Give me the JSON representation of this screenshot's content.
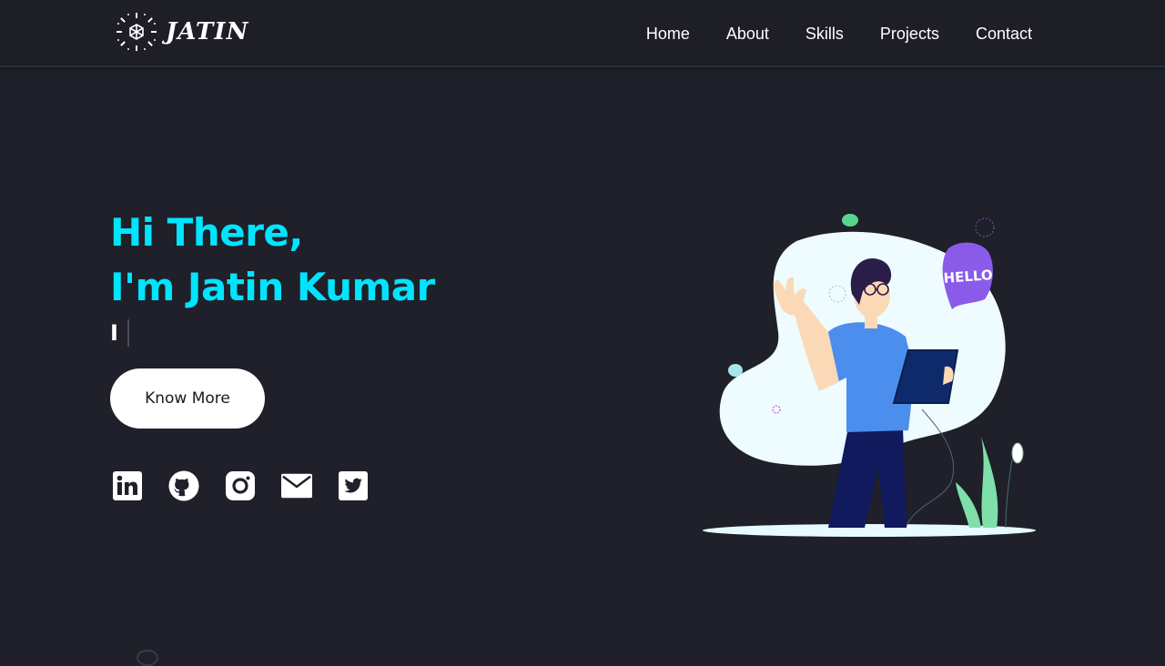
{
  "brand": {
    "name": "JATIN",
    "logo_icon": "sun-logo-icon"
  },
  "nav": {
    "items": [
      {
        "label": "Home"
      },
      {
        "label": "About"
      },
      {
        "label": "Skills"
      },
      {
        "label": "Projects"
      },
      {
        "label": "Contact"
      }
    ]
  },
  "hero": {
    "greeting": "Hi There,",
    "name_line": "I'm Jatin Kumar",
    "typed_text": "I",
    "cta_label": "Know More",
    "illustration_bubble_text": "HELLO"
  },
  "socials": [
    {
      "icon": "linkedin-icon"
    },
    {
      "icon": "github-icon"
    },
    {
      "icon": "instagram-icon"
    },
    {
      "icon": "mail-icon"
    },
    {
      "icon": "twitter-icon"
    }
  ],
  "colors": {
    "background": "#1f2029",
    "navbar": "#1d1e26",
    "accent": "#00e5ff",
    "button_bg": "#ffffff"
  }
}
